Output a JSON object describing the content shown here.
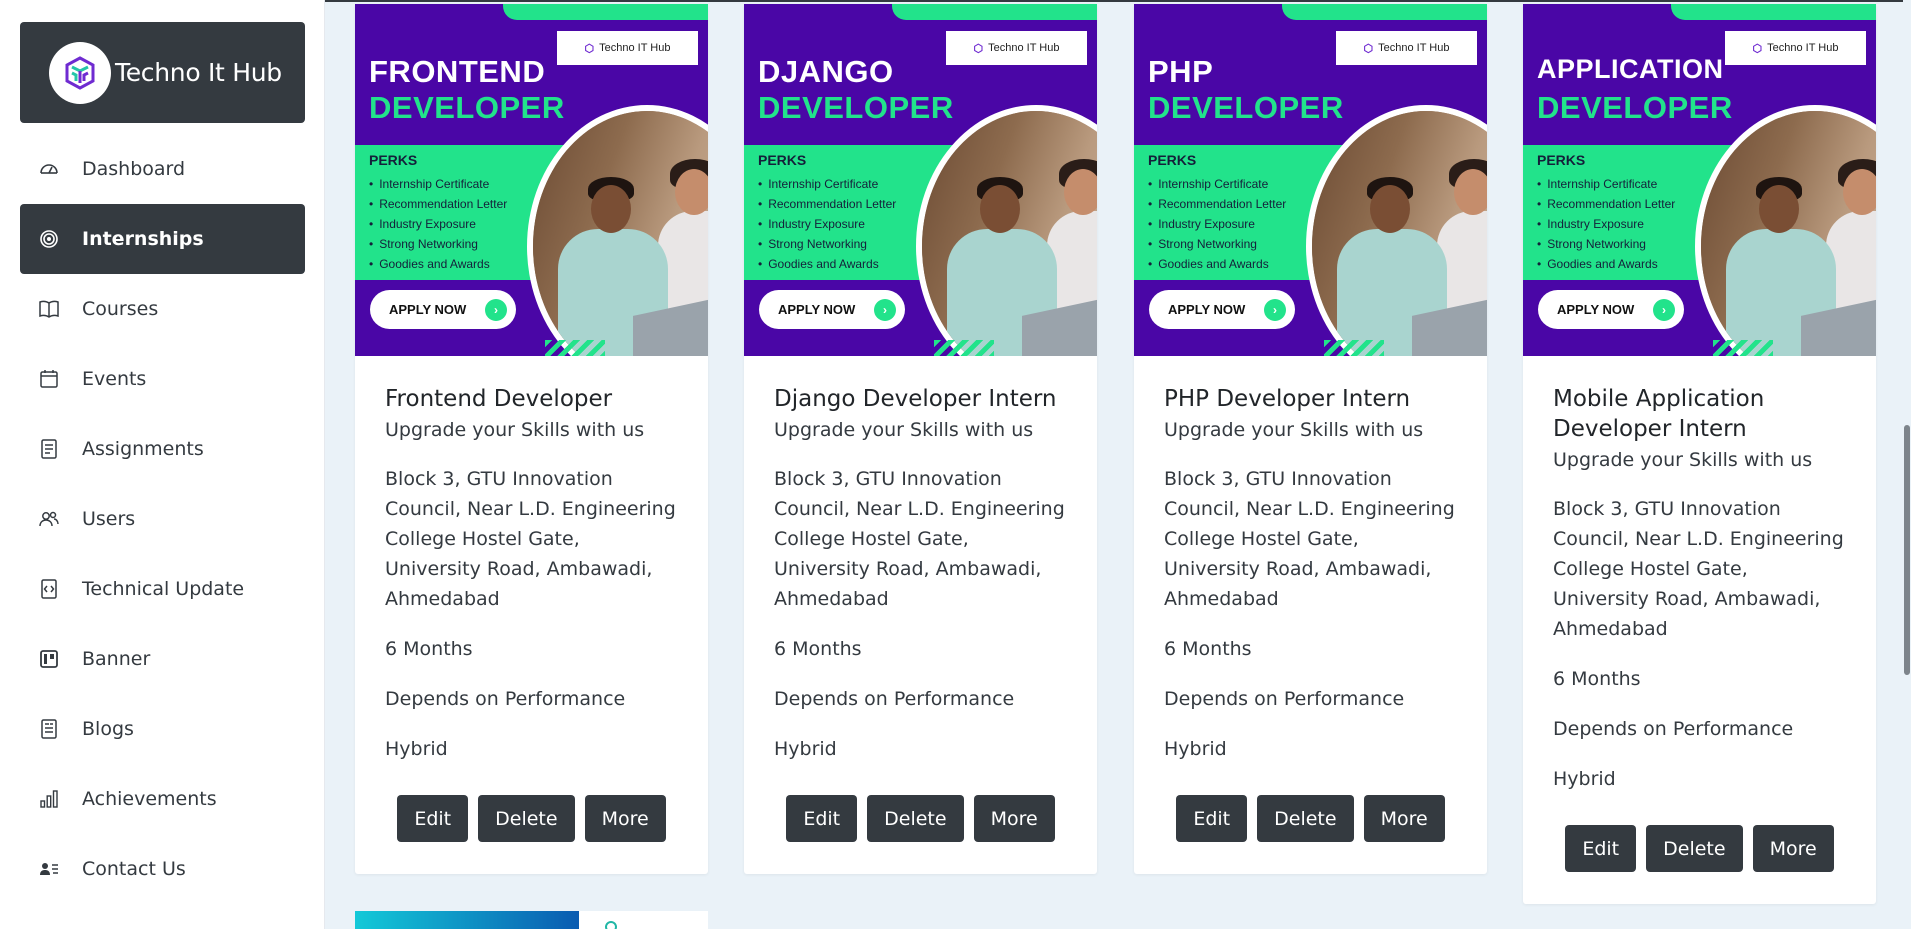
{
  "brand": {
    "name": "Techno It Hub",
    "logo_icon": "techno-it-hub-logo-icon"
  },
  "sidebar": {
    "items": [
      {
        "label": "Dashboard",
        "icon": "dashboard-gauge-icon",
        "active": false
      },
      {
        "label": "Internships",
        "icon": "target-icon",
        "active": true
      },
      {
        "label": "Courses",
        "icon": "book-icon",
        "active": false
      },
      {
        "label": "Events",
        "icon": "calendar-icon",
        "active": false
      },
      {
        "label": "Assignments",
        "icon": "list-document-icon",
        "active": false
      },
      {
        "label": "Users",
        "icon": "users-icon",
        "active": false
      },
      {
        "label": "Technical Update",
        "icon": "code-file-icon",
        "active": false
      },
      {
        "label": "Banner",
        "icon": "banner-icon",
        "active": false
      },
      {
        "label": "Blogs",
        "icon": "blog-document-icon",
        "active": false
      },
      {
        "label": "Achievements",
        "icon": "bar-chart-icon",
        "active": false
      },
      {
        "label": "Contact Us",
        "icon": "contact-card-icon",
        "active": false
      }
    ]
  },
  "poster_common": {
    "brand": "Techno IT Hub",
    "perks_title": "PERKS",
    "perks": [
      "Internship Certificate",
      "Recommendation Letter",
      "Industry Exposure",
      "Strong Networking",
      "Goodies and Awards"
    ],
    "apply": "APPLY NOW",
    "second_line": "DEVELOPER"
  },
  "cards": [
    {
      "poster_title": "FRONTEND",
      "title": "Frontend Developer",
      "subtitle": "Upgrade your Skills with us",
      "address": "Block 3, GTU Innovation Council, Near L.D. Engineering College Hostel Gate, University Road, Ambawadi, Ahmedabad",
      "duration": "6 Months",
      "stipend": "Depends on Performance",
      "mode": "Hybrid"
    },
    {
      "poster_title": "DJANGO",
      "title": "Django Developer Intern",
      "subtitle": "Upgrade your Skills with us",
      "address": "Block 3, GTU Innovation Council, Near L.D. Engineering College Hostel Gate, University Road, Ambawadi, Ahmedabad",
      "duration": "6 Months",
      "stipend": "Depends on Performance",
      "mode": "Hybrid"
    },
    {
      "poster_title": "PHP",
      "title": "PHP Developer Intern",
      "subtitle": "Upgrade your Skills with us",
      "address": "Block 3, GTU Innovation Council, Near L.D. Engineering College Hostel Gate, University Road, Ambawadi, Ahmedabad",
      "duration": "6 Months",
      "stipend": "Depends on Performance",
      "mode": "Hybrid"
    },
    {
      "poster_title": "APPLICATION",
      "title": "Mobile Application Developer Intern",
      "subtitle": "Upgrade your Skills with us",
      "address": "Block 3, GTU Innovation Council, Near L.D. Engineering College Hostel Gate, University Road, Ambawadi, Ahmedabad",
      "duration": "6 Months",
      "stipend": "Depends on Performance",
      "mode": "Hybrid"
    }
  ],
  "actions": {
    "edit": "Edit",
    "delete": "Delete",
    "more": "More"
  },
  "colors": {
    "dark": "#343a40",
    "background": "#eaf2f8",
    "poster_purple": "#4a06a6",
    "poster_green": "#22e38b"
  }
}
